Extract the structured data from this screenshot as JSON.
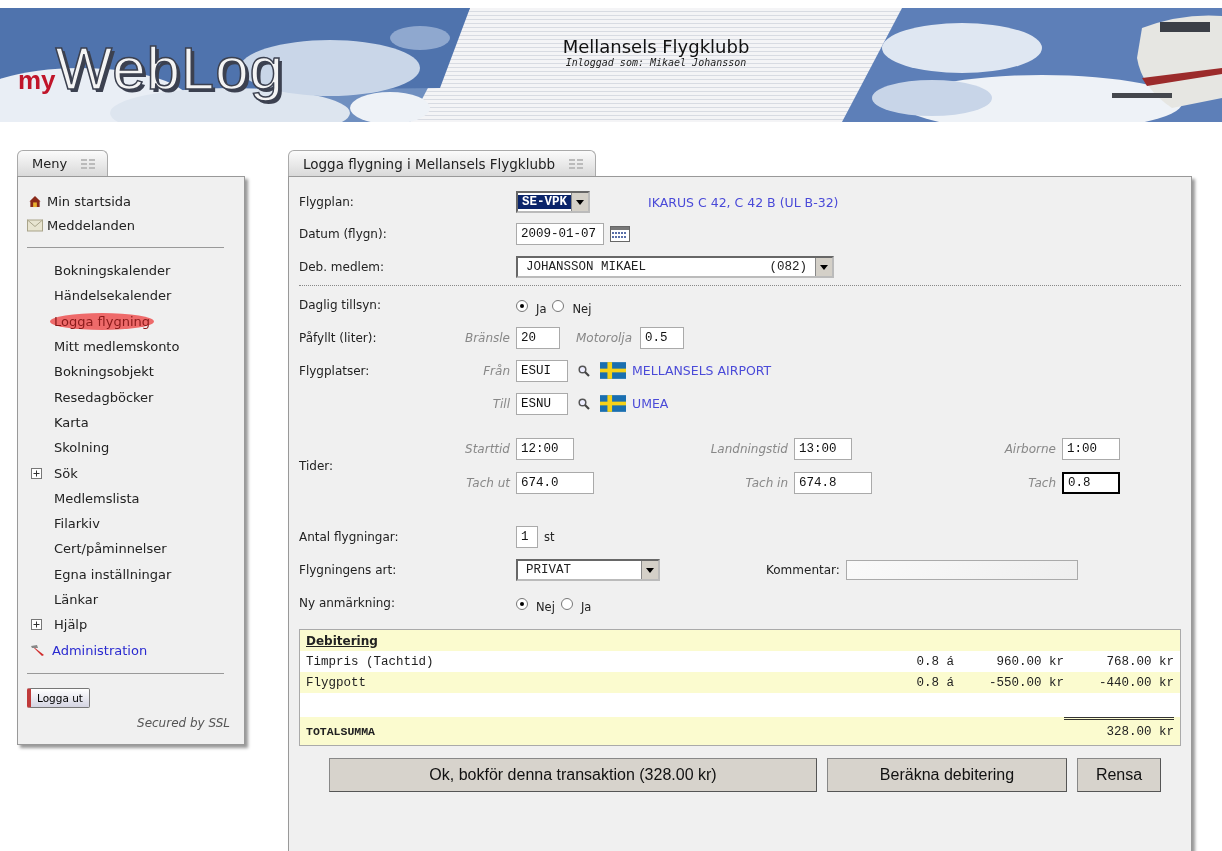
{
  "header": {
    "logo_prefix": "my",
    "logo_name": "WebLog",
    "club": "Mellansels Flygklubb",
    "logged_in": "Inloggad som: Mikael Johansson"
  },
  "menu": {
    "title": "Meny",
    "top_items": [
      {
        "kind": "home",
        "label": "Min startsida"
      },
      {
        "kind": "mail",
        "label": "Meddelanden"
      }
    ],
    "items": [
      {
        "kind": "link",
        "label": "Bokningskalender",
        "selected": false
      },
      {
        "kind": "link",
        "label": "Händelsekalender",
        "selected": false
      },
      {
        "kind": "link",
        "label": "Logga flygning",
        "selected": true
      },
      {
        "kind": "link",
        "label": "Mitt medlemskonto",
        "selected": false
      },
      {
        "kind": "link",
        "label": "Bokningsobjekt",
        "selected": false
      },
      {
        "kind": "link",
        "label": "Resedagböcker",
        "selected": false
      },
      {
        "kind": "link",
        "label": "Karta",
        "selected": false
      },
      {
        "kind": "link",
        "label": "Skolning",
        "selected": false
      },
      {
        "kind": "group",
        "label": "Sök",
        "selected": false,
        "expanded": false
      },
      {
        "kind": "link",
        "label": "Medlemslista",
        "selected": false
      },
      {
        "kind": "link",
        "label": "Filarkiv",
        "selected": false
      },
      {
        "kind": "link",
        "label": "Cert/påminnelser",
        "selected": false
      },
      {
        "kind": "link",
        "label": "Egna inställningar",
        "selected": false
      },
      {
        "kind": "link",
        "label": "Länkar",
        "selected": false
      },
      {
        "kind": "group",
        "label": "Hjälp",
        "selected": false,
        "expanded": false
      },
      {
        "kind": "admin",
        "label": "Administration",
        "selected": false
      }
    ],
    "logout": "Logga ut",
    "secured": "Secured by SSL"
  },
  "form": {
    "title": "Logga flygning i Mellansels Flygklubb",
    "aircraft": {
      "label": "Flygplan:",
      "value": "SE-VPK",
      "model": "IKARUS C 42, C 42 B (UL B-32)"
    },
    "date": {
      "label": "Datum (flygn):",
      "value": "2009-01-07"
    },
    "member": {
      "label": "Deb. medlem:",
      "name": "JOHANSSON MIKAEL",
      "number": "(082)"
    },
    "inspection": {
      "label": "Daglig tillsyn:",
      "options": [
        {
          "label": "Ja",
          "selected": true
        },
        {
          "label": "Nej",
          "selected": false
        }
      ]
    },
    "refuel": {
      "label": "Påfyllt (liter):",
      "fuel_label": "Bränsle",
      "fuel": "20",
      "oil_label": "Motorolja",
      "oil": "0.5"
    },
    "airfields": {
      "label": "Flygplatser:",
      "legs": [
        {
          "label": "Från",
          "code": "ESUI",
          "name": "MELLANSELS AIRPORT"
        },
        {
          "label": "Till",
          "code": "ESNU",
          "name": "UMEA"
        }
      ]
    },
    "times": {
      "label": "Tider:",
      "fields": [
        {
          "label": "Starttid",
          "value": "12:00",
          "focused": false
        },
        {
          "label": "Landningstid",
          "value": "13:00",
          "focused": false
        },
        {
          "label": "Airborne",
          "value": "1:00",
          "focused": false
        },
        {
          "label": "Tach ut",
          "value": "674.0",
          "focused": false
        },
        {
          "label": "Tach in",
          "value": "674.8",
          "focused": false
        },
        {
          "label": "Tach",
          "value": "0.8",
          "focused": true
        }
      ]
    },
    "count": {
      "label": "Antal flygningar:",
      "value": "1",
      "unit": "st"
    },
    "flight_type": {
      "label": "Flygningens art:",
      "value": "PRIVAT"
    },
    "comment": {
      "label": "Kommentar:"
    },
    "remark": {
      "label": "Ny anmärkning:",
      "options": [
        {
          "label": "Nej",
          "selected": true
        },
        {
          "label": "Ja",
          "selected": false
        }
      ]
    }
  },
  "debit": {
    "title": "Debitering",
    "rows": [
      {
        "description": "Timpris (Tachtid)",
        "quantity": "0.8 á",
        "price": "960.00 kr",
        "amount": "768.00 kr"
      },
      {
        "description": "Flygpott",
        "quantity": "0.8 á",
        "price": "-550.00 kr",
        "amount": "-440.00 kr"
      }
    ],
    "total_label": "TOTALSUMMA",
    "total": "328.00 kr"
  },
  "buttons": [
    "Ok, bokför denna transaktion (328.00 kr)",
    "Beräkna debitering",
    "Rensa"
  ]
}
